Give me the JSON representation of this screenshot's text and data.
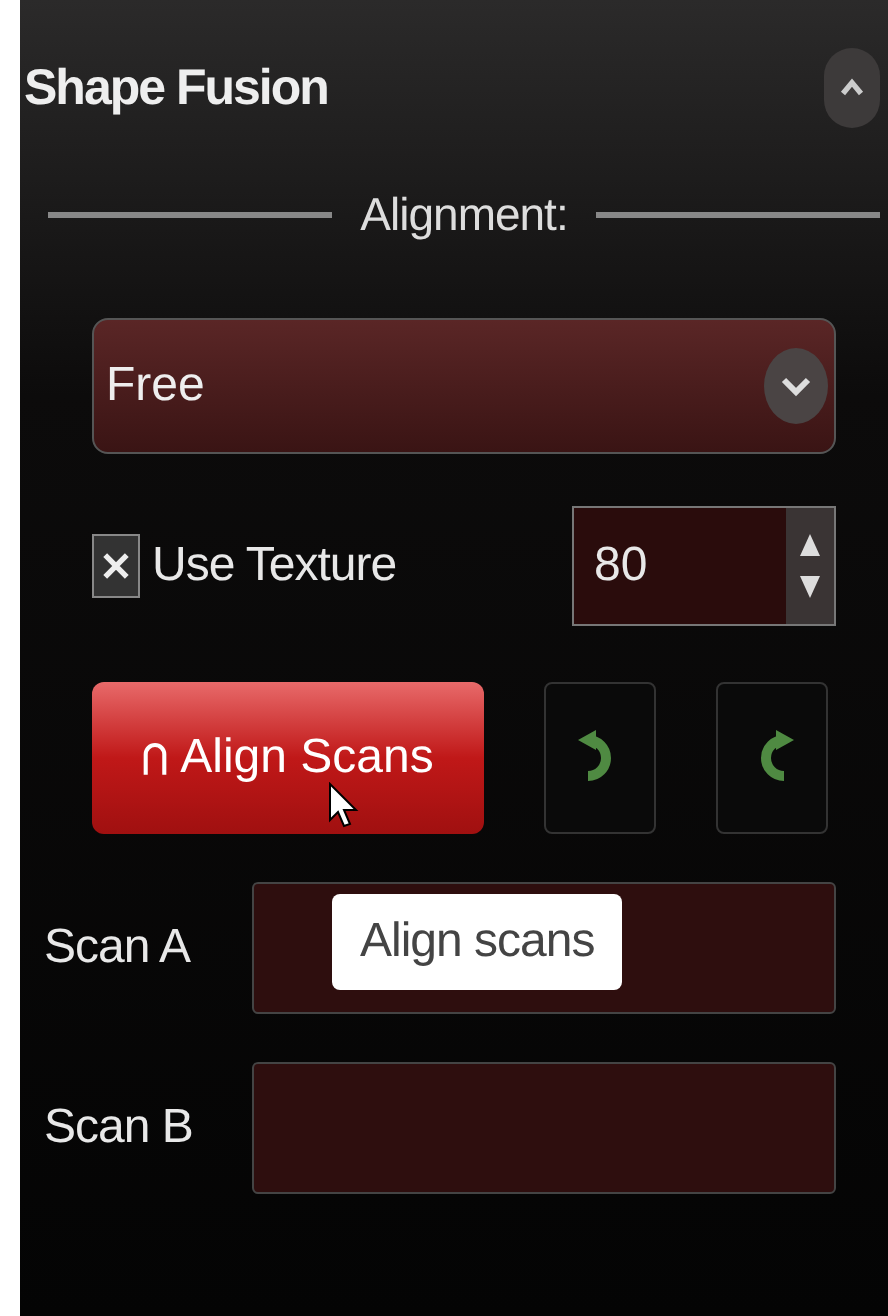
{
  "panel": {
    "title": "Shape Fusion",
    "expanded": true
  },
  "alignment": {
    "heading": "Alignment:",
    "mode": "Free"
  },
  "use_texture": {
    "label": "Use Texture",
    "checked": true,
    "value": "80"
  },
  "align_button": {
    "label": "Align Scans"
  },
  "tooltip": {
    "text": "Align scans"
  },
  "scans": [
    {
      "label": "Scan A"
    },
    {
      "label": "Scan B"
    }
  ]
}
